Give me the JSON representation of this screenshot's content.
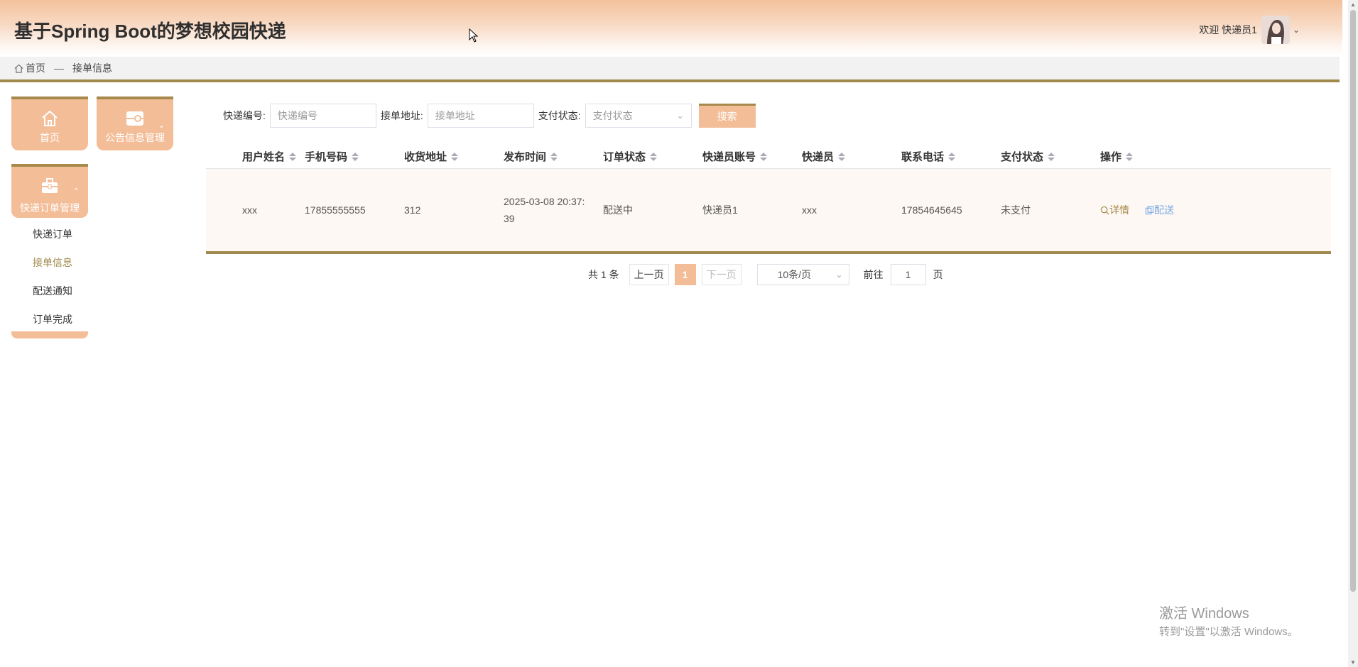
{
  "header": {
    "title": "基于Spring Boot的梦想校园快递",
    "welcome": "欢迎 快递员1"
  },
  "breadcrumb": {
    "home": "首页",
    "separator": "—",
    "current": "接单信息"
  },
  "sidebar": {
    "home_label": "首页",
    "notice_label": "公告信息管理",
    "order_mgmt_label": "快递订单管理",
    "sub_items": [
      "快递订单",
      "接单信息",
      "配送通知",
      "订单完成"
    ]
  },
  "search": {
    "express_no_label": "快递编号:",
    "express_no_placeholder": "快递编号",
    "address_label": "接单地址:",
    "address_placeholder": "接单地址",
    "pay_status_label": "支付状态:",
    "pay_status_placeholder": "支付状态",
    "button": "搜索"
  },
  "table": {
    "columns": [
      "用户姓名",
      "手机号码",
      "收货地址",
      "发布时间",
      "订单状态",
      "快递员账号",
      "快递员",
      "联系电话",
      "支付状态",
      "操作"
    ],
    "rows": [
      {
        "user_name": "xxx",
        "phone": "17855555555",
        "address": "312",
        "publish_time_1": "2025-03-08 20:37:",
        "publish_time_2": "39",
        "order_status": "配送中",
        "courier_account": "快递员1",
        "courier": "xxx",
        "contact_phone": "17854645645",
        "pay_status": "未支付",
        "detail": "详情",
        "deliver": "配送"
      }
    ]
  },
  "pagination": {
    "total": "共 1 条",
    "prev": "上一页",
    "current": "1",
    "next": "下一页",
    "page_size": "10条/页",
    "goto": "前往",
    "jump_value": "1",
    "page_unit": "页"
  },
  "watermark": {
    "line1": "激活 Windows",
    "line2": "转到\"设置\"以激活 Windows。"
  },
  "colors": {
    "accent": "#f3bd98",
    "border_accent": "#9f8a4c",
    "link_blue": "#79a8e6"
  }
}
